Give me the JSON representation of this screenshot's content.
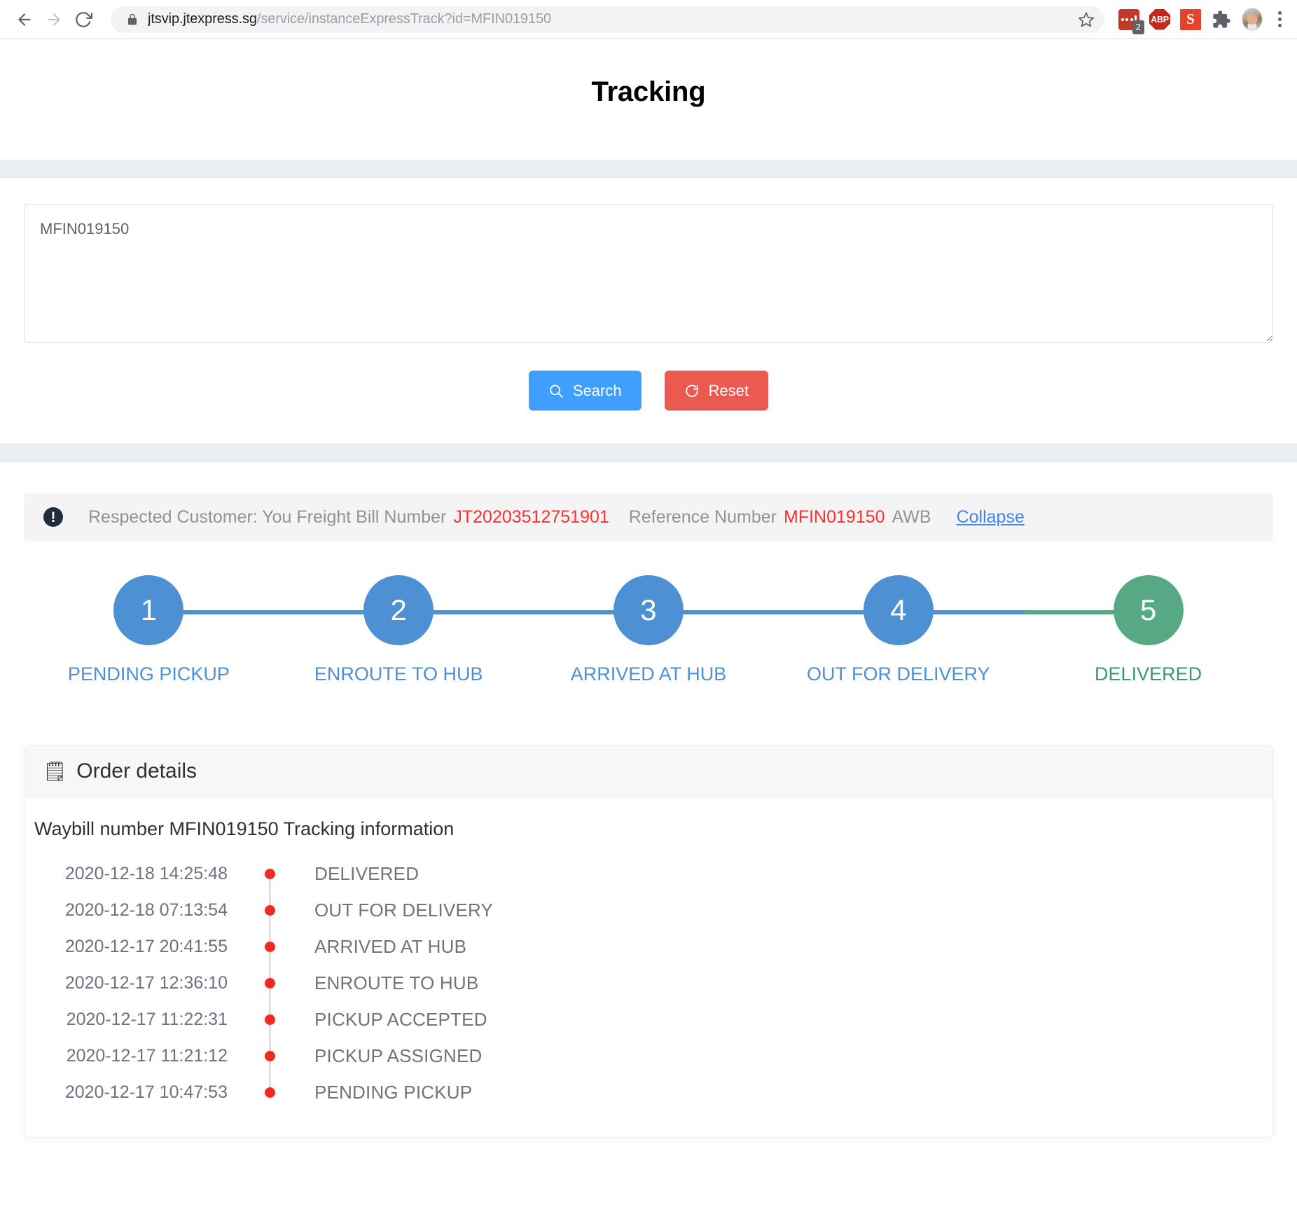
{
  "browser": {
    "back_icon": "back-arrow-icon",
    "forward_icon": "forward-arrow-icon",
    "reload_icon": "reload-icon",
    "lock_icon": "lock-icon",
    "url_host": "jtsvip.jtexpress.sg",
    "url_path": "/service/instanceExpressTrack?id=MFIN019150",
    "url_full": "jtsvip.jtexpress.sg/service/instanceExpressTrack?id=MFIN019150",
    "star_icon": "bookmark-star-icon",
    "extensions": [
      {
        "name": "dots-extension-icon",
        "badge": "2"
      },
      {
        "name": "adblock-plus-icon",
        "label": "ABP"
      },
      {
        "name": "s-extension-icon",
        "label": "S"
      },
      {
        "name": "puzzle-extensions-icon"
      },
      {
        "name": "profile-avatar"
      },
      {
        "name": "kebab-menu-icon"
      }
    ]
  },
  "page": {
    "title": "Tracking"
  },
  "search": {
    "textarea_value": "MFIN019150",
    "textarea_placeholder": "",
    "search_label": "Search",
    "search_icon": "magnifier-icon",
    "reset_label": "Reset",
    "reset_icon": "refresh-icon",
    "search_color": "#409eff",
    "reset_color": "#eb5a51"
  },
  "alert": {
    "icon": "exclamation-circle-icon",
    "prefix": "Respected Customer: You Freight Bill Number",
    "freight_bill_number": "JT20203512751901",
    "reference_label": "Reference Number",
    "reference_number": "MFIN019150",
    "suffix": "AWB",
    "collapse_label": "Collapse",
    "highlight_color": "#ff2f2f",
    "link_color": "#4285f4"
  },
  "stepper": {
    "active_color": "#4d90d4",
    "done_color": "#56a982",
    "steps": [
      {
        "number": "1",
        "label": "PENDING PICKUP",
        "state": "blue"
      },
      {
        "number": "2",
        "label": "ENROUTE TO HUB",
        "state": "blue"
      },
      {
        "number": "3",
        "label": "ARRIVED AT HUB",
        "state": "blue"
      },
      {
        "number": "4",
        "label": "OUT FOR DELIVERY",
        "state": "blue"
      },
      {
        "number": "5",
        "label": "DELIVERED",
        "state": "green"
      }
    ]
  },
  "order_details": {
    "header_icon": "clipboard-icon",
    "header_glyph": "🗒",
    "header_label": "Order details",
    "waybill_line": "Waybill number MFIN019150 Tracking information",
    "timeline": [
      {
        "time": "2020-12-18 14:25:48",
        "status": "DELIVERED"
      },
      {
        "time": "2020-12-18 07:13:54",
        "status": "OUT FOR DELIVERY"
      },
      {
        "time": "2020-12-17 20:41:55",
        "status": "ARRIVED AT HUB"
      },
      {
        "time": "2020-12-17 12:36:10",
        "status": "ENROUTE TO HUB"
      },
      {
        "time": "2020-12-17 11:22:31",
        "status": "PICKUP ACCEPTED"
      },
      {
        "time": "2020-12-17 11:21:12",
        "status": "PICKUP ASSIGNED"
      },
      {
        "time": "2020-12-17 10:47:53",
        "status": "PENDING PICKUP"
      }
    ],
    "dot_color": "#ee2a22"
  }
}
